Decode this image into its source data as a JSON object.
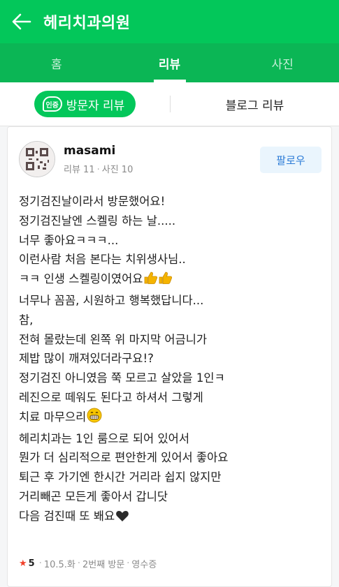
{
  "header": {
    "title": "헤리치과의원"
  },
  "tabs": [
    {
      "label": "홈"
    },
    {
      "label": "리뷰"
    },
    {
      "label": "사진"
    }
  ],
  "subtabs": {
    "badge": "인증",
    "visitor": "방문자 리뷰",
    "blog": "블로그 리뷰"
  },
  "review": {
    "username": "masami",
    "reviews_label": "리뷰 11",
    "photos_label": "사진 10",
    "follow_label": "팔로우",
    "lines": [
      "정기검진날이라서 방문했어요!",
      "정기검진날엔 스켈링 하는 날.....",
      "너무 좋아요ㅋㅋㅋ...",
      "이런사람 처음 본다는 치위생사님..",
      "ㅋㅋ 인생 스켈링이였어요",
      "너무나 꼼꼼, 시원하고 행복했답니다...",
      "참,",
      "전혀 몰랐는데 왼쪽 위 마지막 어금니가",
      "제밥 많이 깨져있더라구요!?",
      "정기검진 아니였음 쭉 모르고 살았을 1인ㅋ",
      "레진으로 떼워도 된다고 하셔서 그렇게",
      "치료 마무으리",
      "헤리치과는 1인 룸으로 되어 있어서",
      "뭔가 더 심리적으로 편안한게 있어서 좋아요",
      "퇴근 후 가기엔 한시간 거리라 쉽지 않지만",
      "거리빼곤 모든게 좋아서 갑니닷",
      "다음 검진때 또 봬요"
    ],
    "footer": {
      "star": "★",
      "rating": "5",
      "date": "10.5.화",
      "visit": "2번째 방문",
      "receipt": "영수증"
    }
  }
}
